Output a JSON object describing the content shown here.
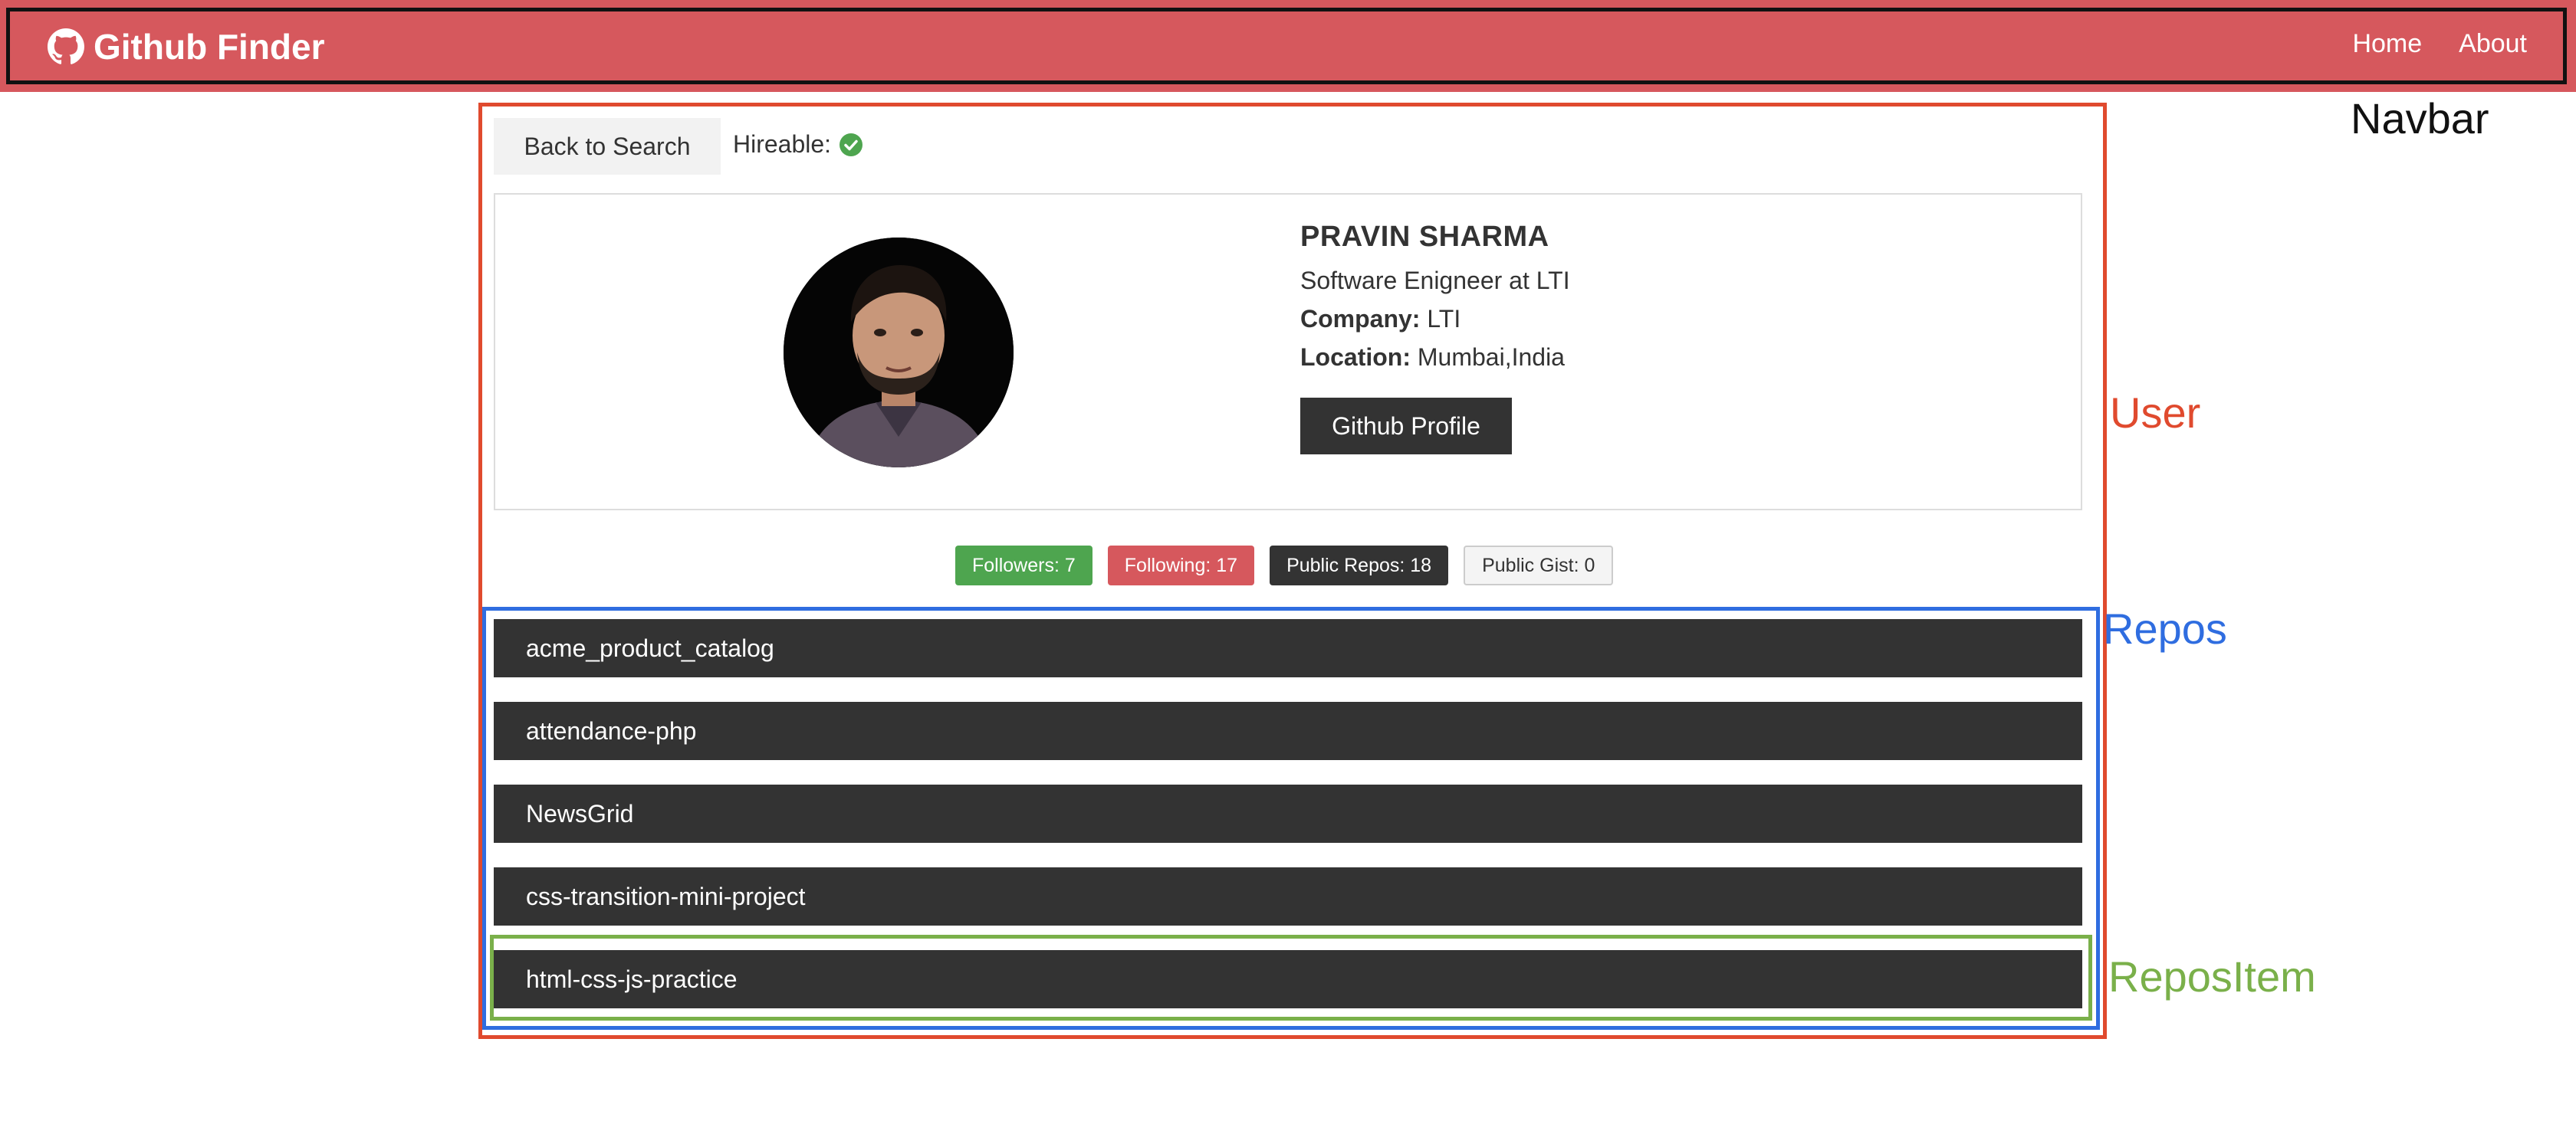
{
  "navbar": {
    "brand": "Github Finder",
    "links": [
      {
        "label": "Home"
      },
      {
        "label": "About"
      }
    ]
  },
  "annotations": {
    "navbar": "Navbar",
    "user": "User",
    "repos": "Repos",
    "repos_item": "ReposItem"
  },
  "user": {
    "back_label": "Back to Search",
    "hireable_label": "Hireable:",
    "hireable": true,
    "name": "PRAVIN SHARMA",
    "bio": "Software Enigneer at LTI",
    "company_label": "Company:",
    "company": "LTI",
    "location_label": "Location:",
    "location": "Mumbai,India",
    "profile_button": "Github Profile"
  },
  "stats": {
    "followers": "Followers: 7",
    "following": "Following: 17",
    "public_repos": "Public Repos: 18",
    "public_gists": "Public Gist: 0"
  },
  "repos": [
    {
      "name": "acme_product_catalog"
    },
    {
      "name": "attendance-php"
    },
    {
      "name": "NewsGrid"
    },
    {
      "name": "css-transition-mini-project"
    },
    {
      "name": "html-css-js-practice"
    }
  ],
  "colors": {
    "navbar": "#d6585d",
    "annotation_user": "#e04a2e",
    "annotation_repos": "#2f6de0",
    "annotation_item": "#7ab04a",
    "success": "#4ea54f",
    "dark": "#333333"
  }
}
